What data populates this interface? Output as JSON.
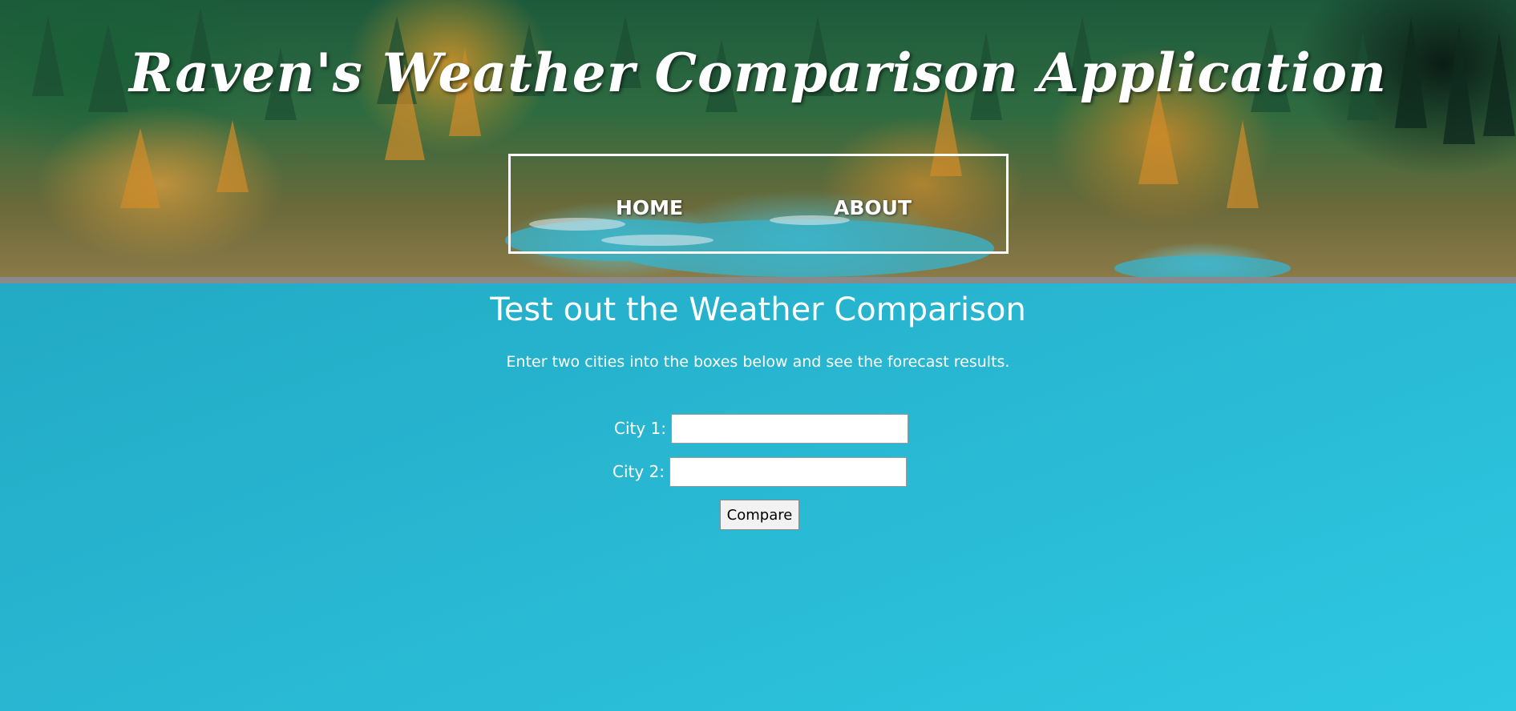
{
  "header": {
    "title": "Raven's Weather Comparison Application",
    "nav": [
      {
        "label": "HOME"
      },
      {
        "label": "ABOUT"
      }
    ]
  },
  "main": {
    "title": "Test out the Weather Comparison",
    "subtitle": "Enter two cities into the boxes below and see the forecast results.",
    "city1": {
      "label": "City 1:",
      "value": "",
      "placeholder": ""
    },
    "city2": {
      "label": "City 2:",
      "value": "",
      "placeholder": ""
    },
    "compare_label": "Compare"
  },
  "colors": {
    "background_start": "#1fa2bb",
    "background_end": "#2ec8e2",
    "divider": "#8a8a8a",
    "text": "#ffffff"
  }
}
